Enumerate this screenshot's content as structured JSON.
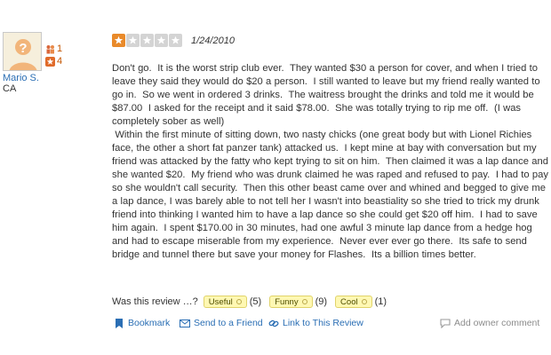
{
  "user": {
    "name": "Mario S.",
    "location": "CA",
    "friends_count": "1",
    "reviews_count": "4",
    "avatar_icon": "question-mark-person-icon"
  },
  "review": {
    "rating": 1,
    "max_rating": 5,
    "date": "1/24/2010",
    "text": "Don't go.  It is the worst strip club ever.  They wanted $30 a person for cover, and when I tried to leave they said they would do $20 a person.  I still wanted to leave but my friend really wanted to go in.  So we went in ordered 3 drinks.  The waitress brought the drinks and told me it would be $87.00  I asked for the receipt and it said $78.00.  She was totally trying to rip me off.  (I was completely sober as well)\n Within the first minute of sitting down, two nasty chicks (one great body but with Lionel Richies face, the other a short fat panzer tank) attacked us.  I kept mine at bay with conversation but my friend was attacked by the fatty who kept trying to sit on him.  Then claimed it was a lap dance and she wanted $20.  My friend who was drunk claimed he was raped and refused to pay.  I had to pay so she wouldn't call security.  Then this other beast came over and whined and begged to give me a lap dance, I was barely able to not tell her I wasn't into beastiality so she tried to trick my drunk friend into thinking I wanted him to have a lap dance so she could get $20 off him.  I had to save him again.  I spent $170.00 in 30 minutes, had one awful 3 minute lap dance from a hedge hog and had to escape miserable from my experience.  Never ever ever go there.  Its safe to send bridge and tunnel there but save your money for Flashes.  Its a billion times better."
  },
  "feedback": {
    "question": "Was this review …?",
    "buttons": [
      {
        "label": "Useful",
        "count": "(5)"
      },
      {
        "label": "Funny",
        "count": "(9)"
      },
      {
        "label": "Cool",
        "count": "(1)"
      }
    ]
  },
  "actions": {
    "bookmark": "Bookmark",
    "send_to_friend": "Send to a Friend",
    "link_to_review": "Link to This Review",
    "add_owner_comment": "Add owner comment"
  },
  "colors": {
    "link": "#2a6eb4",
    "star_on": "#e98a2a",
    "star_off": "#d4d4d4",
    "vote_bg": "#fff8b3",
    "stat_orange": "#c45500"
  }
}
